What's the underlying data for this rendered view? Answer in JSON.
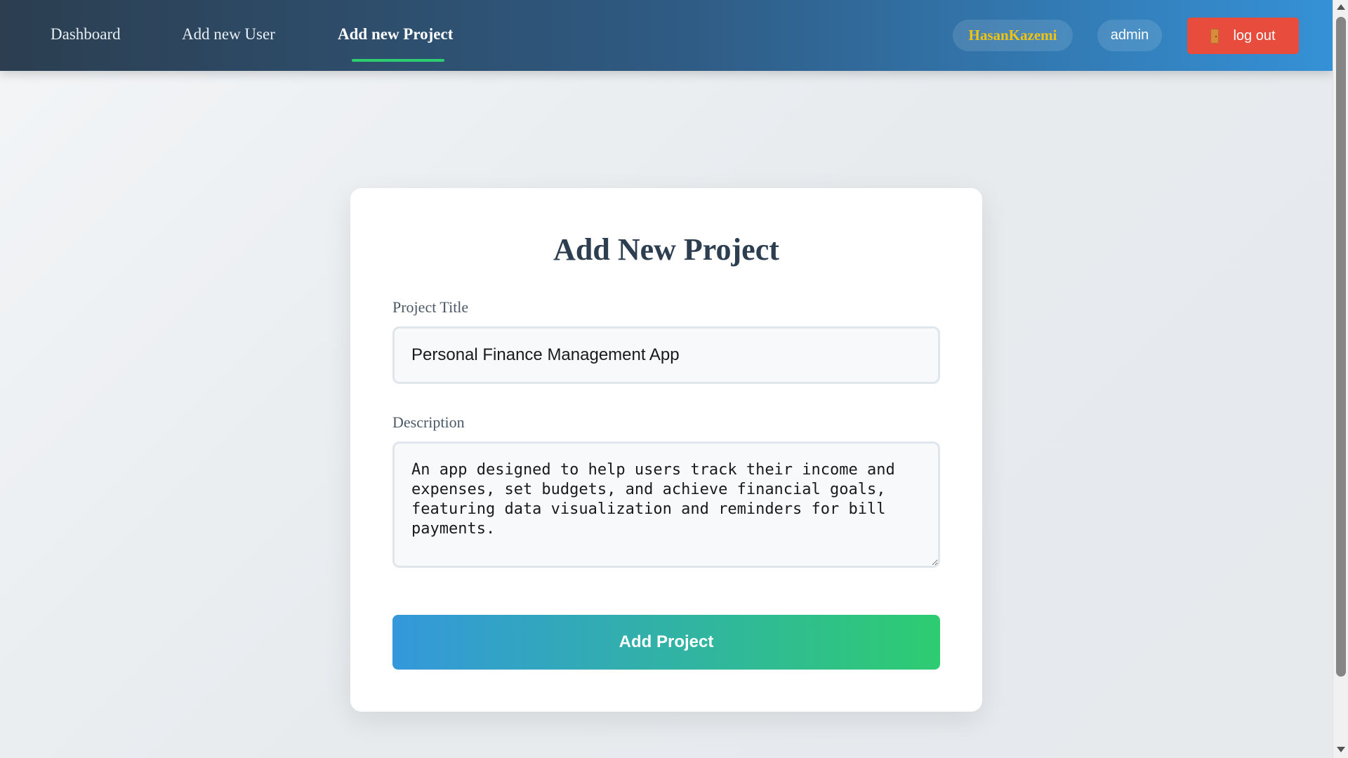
{
  "nav": {
    "links": [
      {
        "label": "Dashboard"
      },
      {
        "label": "Add new User"
      },
      {
        "label": "Add new Project"
      }
    ],
    "active_index": 2,
    "username": "HasanKazemi",
    "role": "admin",
    "logout_label": "log out",
    "logout_icon": "door-icon"
  },
  "form": {
    "title": "Add New Project",
    "project_title_label": "Project Title",
    "project_title_value": "Personal Finance Management App",
    "description_label": "Description",
    "description_value": "An app designed to help users track their income and expenses, set budgets, and achieve financial goals, featuring data visualization and reminders for bill payments.",
    "submit_label": "Add Project"
  },
  "colors": {
    "accent_green": "#2ecc71",
    "accent_blue": "#3498db",
    "logout_red": "#e74c3c",
    "username_gold": "#f1c40f",
    "heading": "#2c3e50"
  }
}
